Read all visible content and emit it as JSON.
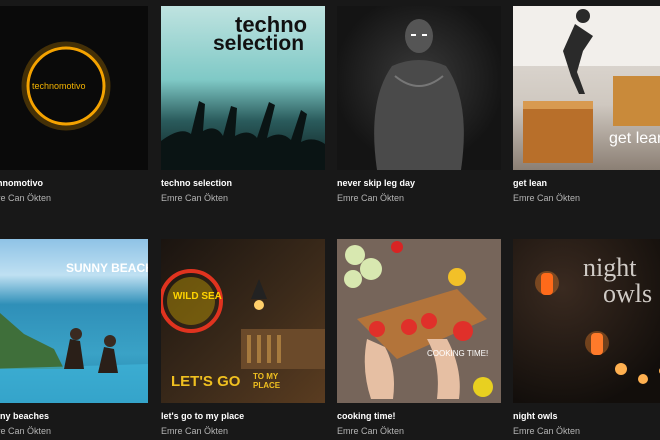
{
  "playlists": [
    {
      "title": "technomotivo",
      "author": "Emre Can Ökten",
      "cover_text": "technomotivo"
    },
    {
      "title": "techno selection",
      "author": "Emre Can Ökten",
      "cover_text_1": "techno",
      "cover_text_2": "selection"
    },
    {
      "title": "never skip leg day",
      "author": "Emre Can Ökten"
    },
    {
      "title": "get lean",
      "author": "Emre Can Ökten",
      "cover_text": "get lean"
    },
    {
      "title": "sunny beaches",
      "author": "Emre Can Ökten",
      "cover_text": "SUNNY BEACHES"
    },
    {
      "title": "let's go to my place",
      "author": "Emre Can Ökten",
      "cover_text_1": "LET'S GO",
      "cover_text_2": "TO MY",
      "cover_text_3": "PLACE",
      "sign_text": "WILD SEA"
    },
    {
      "title": "cooking time!",
      "author": "Emre Can Ökten",
      "cover_text": "COOKING TIME!"
    },
    {
      "title": "night owls",
      "author": "Emre Can Ökten",
      "cover_text_1": "night",
      "cover_text_2": "owls"
    }
  ],
  "colors": {
    "background": "#181818",
    "title": "#ffffff",
    "author": "#b3b3b3"
  }
}
